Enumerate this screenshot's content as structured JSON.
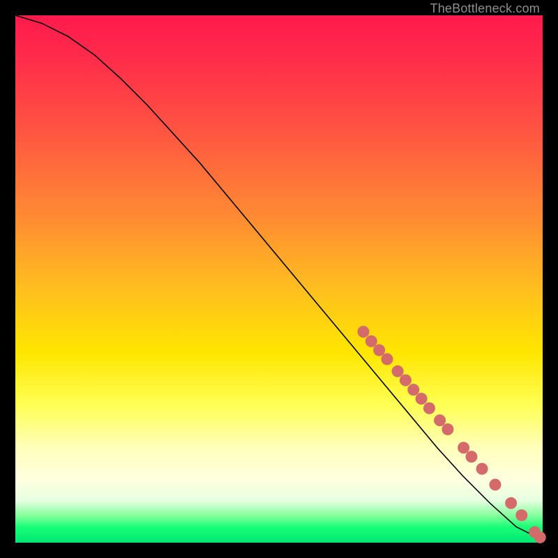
{
  "attribution": "TheBottleneck.com",
  "chart_data": {
    "type": "line",
    "title": "",
    "xlabel": "",
    "ylabel": "",
    "xlim": [
      0,
      100
    ],
    "ylim": [
      0,
      100
    ],
    "curve": {
      "name": "bottleneck-curve",
      "x": [
        0,
        5,
        10,
        15,
        20,
        25,
        30,
        35,
        40,
        45,
        50,
        55,
        60,
        65,
        70,
        75,
        80,
        85,
        90,
        95,
        100
      ],
      "y": [
        100,
        98.5,
        96,
        92.5,
        88,
        83,
        77.5,
        72,
        66,
        60,
        54,
        48,
        42,
        36,
        30,
        24,
        18,
        12.5,
        7.5,
        3,
        0.5
      ]
    },
    "series": [
      {
        "name": "data-points",
        "type": "scatter",
        "points": [
          {
            "x": 66.0,
            "y": 40.0
          },
          {
            "x": 67.5,
            "y": 38.2
          },
          {
            "x": 69.0,
            "y": 36.5
          },
          {
            "x": 70.5,
            "y": 34.8
          },
          {
            "x": 72.5,
            "y": 32.5
          },
          {
            "x": 74.0,
            "y": 30.8
          },
          {
            "x": 75.5,
            "y": 29.0
          },
          {
            "x": 77.0,
            "y": 27.3
          },
          {
            "x": 78.5,
            "y": 25.5
          },
          {
            "x": 80.5,
            "y": 23.2
          },
          {
            "x": 82.0,
            "y": 21.5
          },
          {
            "x": 85.0,
            "y": 18.0
          },
          {
            "x": 86.5,
            "y": 16.3
          },
          {
            "x": 88.5,
            "y": 14.0
          },
          {
            "x": 91.0,
            "y": 11.0
          },
          {
            "x": 94.0,
            "y": 7.5
          },
          {
            "x": 96.0,
            "y": 5.2
          },
          {
            "x": 98.5,
            "y": 2.0
          },
          {
            "x": 99.5,
            "y": 1.0
          }
        ]
      }
    ],
    "background_gradient": {
      "stops": [
        {
          "pos": 0.0,
          "color": "#ff1a4d"
        },
        {
          "pos": 0.5,
          "color": "#ffbf1f"
        },
        {
          "pos": 0.7,
          "color": "#ffff55"
        },
        {
          "pos": 0.95,
          "color": "#80ff9a"
        },
        {
          "pos": 1.0,
          "color": "#00e673"
        }
      ]
    }
  },
  "colors": {
    "dot": "#d46a6a",
    "curve": "#000000",
    "page_bg": "#000000"
  }
}
